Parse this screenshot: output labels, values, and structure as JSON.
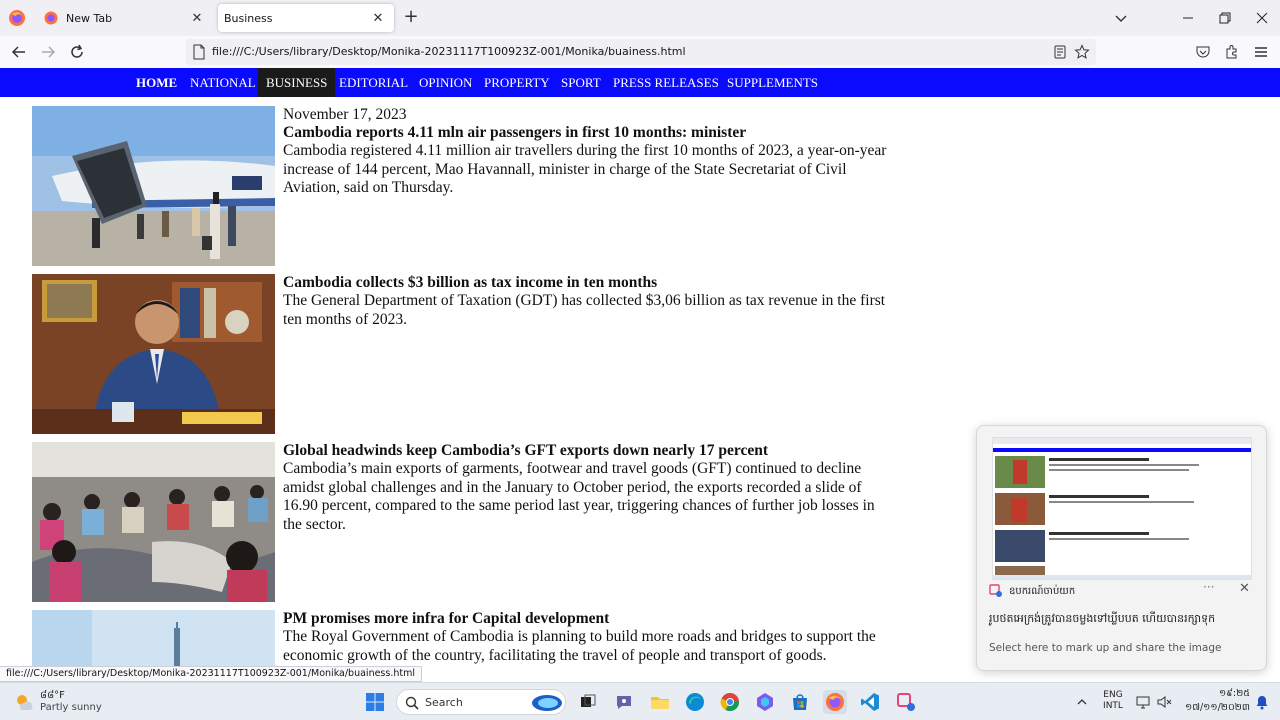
{
  "browser": {
    "tabs": [
      {
        "title": "New Tab",
        "active": false
      },
      {
        "title": "Business",
        "active": true
      }
    ],
    "url": "file:///C:/Users/library/Desktop/Monika-20231117T100923Z-001/Monika/buainess.html",
    "status_link": "file:///C:/Users/library/Desktop/Monika-20231117T100923Z-001/Monika/buainess.html"
  },
  "nav": {
    "items": [
      "HOME",
      "NATIONAL",
      "BUSINESS",
      "EDITORIAL",
      "OPINION",
      "PROPERTY",
      "SPORT",
      "PRESS RELEASES",
      "SUPPLEMENTS"
    ],
    "current": "BUSINESS"
  },
  "articles": [
    {
      "date": "November 17, 2023",
      "headline": "Cambodia reports 4.11 mln air passengers in first 10 months: minister",
      "summary": "Cambodia registered 4.11 million air travellers during the first 10 months of 2023, a year-on-year increase of 144 percent, Mao Havannall, minister in charge of the State Secretariat of Civil Aviation, said on Thursday."
    },
    {
      "date": "",
      "headline": "Cambodia collects $3 billion as tax income in ten months",
      "summary": "The General Department of Taxation (GDT) has collected $3,06 billion as tax revenue in the first ten months of 2023."
    },
    {
      "date": "",
      "headline": "Global headwinds keep Cambodia’s GFT exports down nearly 17 percent",
      "summary": "Cambodia’s main exports of garments, footwear and travel goods (GFT) continued to decline amidst global challenges and in the January to October period, the exports recorded a slide of 16.90 percent, compared to the same period last year, triggering chances of further job losses in the sector."
    },
    {
      "date": "",
      "headline": "PM promises more infra for Capital development",
      "summary": "The Royal Government of Cambodia is planning to build more roads and bridges to support the economic growth of the country, facilitating the travel of people and transport of goods."
    }
  ],
  "notification": {
    "app_name": "ឧបករណ៍ចាប់យក",
    "title": "រូបថតអេក្រង់ត្រូវបានចម្លងទៅឃ្លីបបត ហើយបានរក្សាទុក",
    "body": "Select here to mark up and share the image"
  },
  "taskbar": {
    "weather_temp": "៨៨°F",
    "weather_desc": "Partly sunny",
    "search_label": "Search",
    "lang_top": "ENG",
    "lang_bottom": "INTL",
    "time": "១៩:២៥",
    "date": "១៧/១១/២០២៣"
  },
  "colors": {
    "nav_bg": "#0a0aff",
    "nav_current_bg": "#1a1a1a"
  }
}
